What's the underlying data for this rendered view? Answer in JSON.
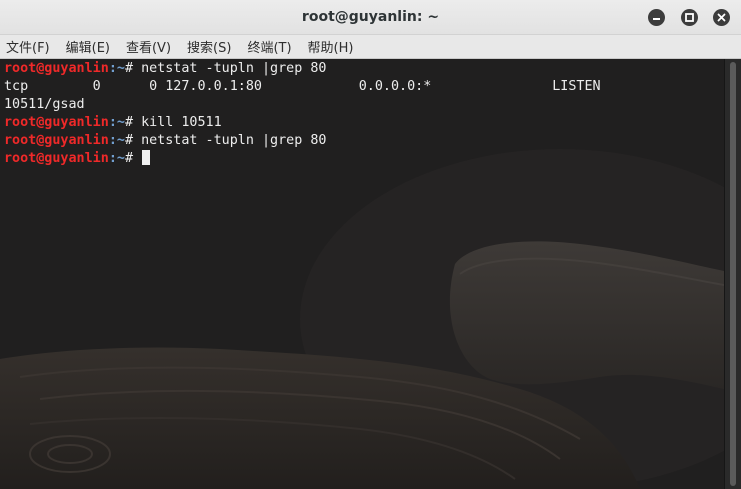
{
  "window": {
    "title": "root@guyanlin: ~"
  },
  "menu": {
    "items": [
      "文件(F)",
      "编辑(E)",
      "查看(V)",
      "搜索(S)",
      "终端(T)",
      "帮助(H)"
    ]
  },
  "terminal": {
    "prompt": {
      "user_host": "root@guyanlin",
      "path_sep": ":~# "
    },
    "lines": [
      {
        "type": "prompt",
        "command": "netstat -tupln |grep 80"
      },
      {
        "type": "output",
        "text": "tcp        0      0 127.0.0.1:80            0.0.0.0:*               LISTEN"
      },
      {
        "type": "output",
        "text": "10511/gsad"
      },
      {
        "type": "prompt",
        "command": "kill 10511"
      },
      {
        "type": "prompt",
        "command": "netstat -tupln |grep 80"
      },
      {
        "type": "prompt",
        "command": ""
      }
    ]
  },
  "colors": {
    "prompt_user": "#ef2929",
    "prompt_path": "#729fcf",
    "terminal_bg": "#212020",
    "text": "#ededed"
  }
}
